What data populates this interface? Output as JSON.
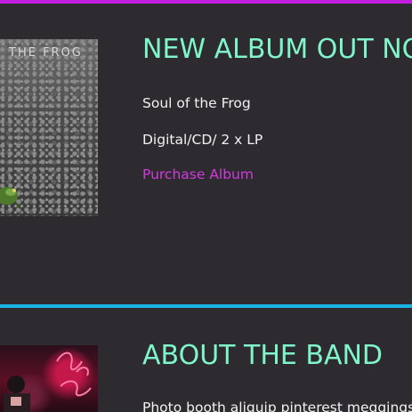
{
  "colors": {
    "background": "#2d2b30",
    "top_accent": "#c21ddf",
    "section_divider": "#1ab3e6",
    "heading": "#7ff5c9",
    "body_text": "#f2f2f2",
    "link": "#d23bde"
  },
  "album_section": {
    "artwork_text": "THE FROG",
    "title": "NEW ALBUM OUT NO",
    "album_name": "Soul of the Frog",
    "formats": "Digital/CD/ 2 x LP",
    "purchase_link": "Purchase Album"
  },
  "about_section": {
    "title": "ABOUT THE BAND",
    "intro": "Photo booth aliquip pinterest meggings"
  }
}
